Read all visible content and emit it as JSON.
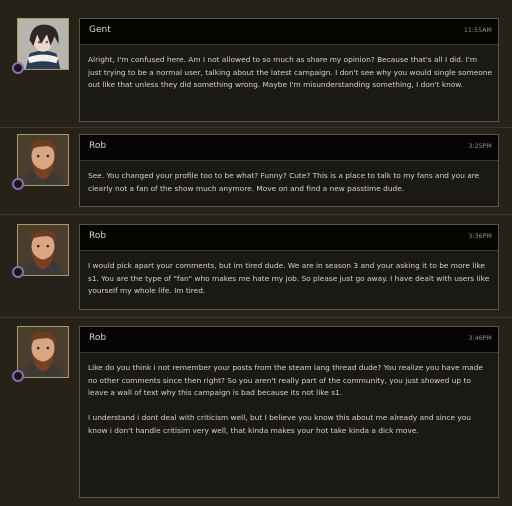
{
  "posts": [
    {
      "author": "Gent",
      "time": "11:55AM",
      "avatar": "gent-avatar",
      "paragraphs": [
        "Alright, I'm confused here. Am I not allowed to so much as share my opinion? Because that's all I did. I'm just trying to be a normal user, talking about the latest campaign. I don't see why you would single someone out like that unless they did something wrong. Maybe I'm misunderstanding something, I don't know."
      ]
    },
    {
      "author": "Rob",
      "time": "3:25PM",
      "avatar": "rob-avatar",
      "paragraphs": [
        "See. You changed your profile too to be what? Funny? Cute? This is a place to talk to my fans and you are clearly not a fan of the show much anymore. Move on and find a new passtime dude."
      ]
    },
    {
      "author": "Rob",
      "time": "3:36PM",
      "avatar": "rob-avatar",
      "paragraphs": [
        "I would pick apart your comments, but im tired dude. We are in season 3 and your asking it to be more like s1. You are the type of \"fan\" who makes me hate my job. So please just go away. I have dealt with users like yourself my whole life. Im tired."
      ]
    },
    {
      "author": "Rob",
      "time": "3:46PM",
      "avatar": "rob-avatar",
      "paragraphs": [
        "Like do you think i not remember your posts from the steam lang thread dude? You realize you have made no other comments since then right? So you aren't really part of the community, you just showed up to leave a wall of text why this campaign is bad because its not like s1.",
        "I understand i dont deal with criticism well, but I believe you know this about me already and since you know i don't handle critisim very well, that kinda makes your hot take kinda a dick move."
      ]
    }
  ],
  "colors": {
    "background": "#262219",
    "message_body": "#1b1915",
    "message_header": "#050504",
    "status_ring": "#8a6bb8"
  }
}
